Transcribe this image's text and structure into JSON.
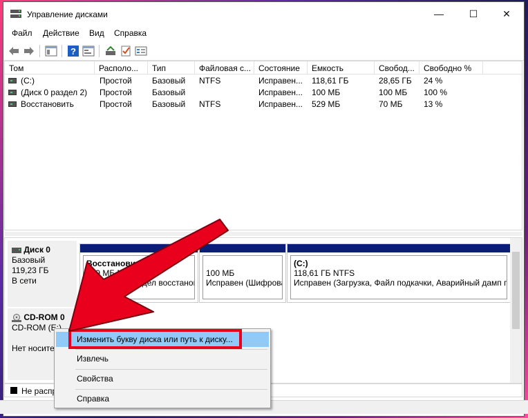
{
  "window": {
    "title": "Управление дисками"
  },
  "controls": {
    "minimize": "—",
    "maximize": "☐",
    "close": "✕"
  },
  "menu": [
    "Файл",
    "Действие",
    "Вид",
    "Справка"
  ],
  "volume_list": {
    "columns": [
      "Том",
      "Располо...",
      "Тип",
      "Файловая с...",
      "Состояние",
      "Емкость",
      "Свобод...",
      "Свободно %"
    ],
    "rows": [
      [
        "(C:)",
        "Простой",
        "Базовый",
        "NTFS",
        "Исправен...",
        "118,61 ГБ",
        "28,65 ГБ",
        "24 %"
      ],
      [
        "(Диск 0 раздел 2)",
        "Простой",
        "Базовый",
        "",
        "Исправен...",
        "100 МБ",
        "100 МБ",
        "100 %"
      ],
      [
        "Восстановить",
        "Простой",
        "Базовый",
        "NTFS",
        "Исправен...",
        "529 МБ",
        "70 МБ",
        "13 %"
      ]
    ]
  },
  "disks": [
    {
      "name": "Диск 0",
      "type": "Базовый",
      "size": "119,23 ГБ",
      "status": "В сети",
      "partitions": [
        {
          "title": "Восстановить",
          "line2": "529 МБ NTFS",
          "line3": "Исправен (Раздел восстанов"
        },
        {
          "title": "",
          "line2": "100 МБ",
          "line3": "Исправен (Шифрова"
        },
        {
          "title": "(C:)",
          "line2": "118,61 ГБ NTFS",
          "line3": "Исправен (Загрузка, Файл подкачки, Аварийный дамп п"
        }
      ]
    },
    {
      "name": "CD-ROM 0",
      "type": "CD-ROM (E:)",
      "status": "Нет носителя"
    }
  ],
  "legend": {
    "unallocated": "Не распределена"
  },
  "context_menu": {
    "items": [
      "Изменить букву диска или путь к диску...",
      "Извлечь",
      "Свойства",
      "Справка"
    ],
    "highlighted_index": 0
  },
  "colors": {
    "partition_bar": "#0a1e78",
    "highlight": "#91c9f7",
    "annotation_red": "#e8001c"
  },
  "icons": {
    "toolbar": [
      "back-icon",
      "forward-icon",
      "console-tree-icon",
      "help-icon",
      "properties-icon",
      "connect-icon",
      "checklist-icon",
      "rescan-icon"
    ]
  }
}
